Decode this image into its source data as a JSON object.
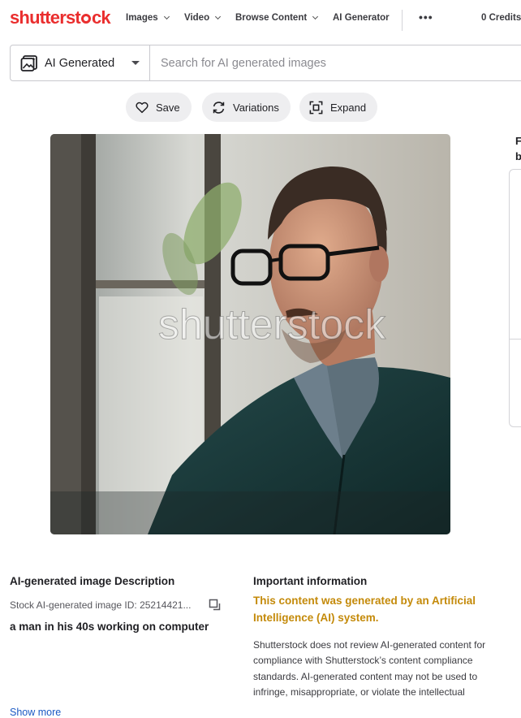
{
  "header": {
    "logo": {
      "left": "shutterst",
      "right": "ck"
    },
    "nav": [
      {
        "label": "Images",
        "has_menu": true
      },
      {
        "label": "Video",
        "has_menu": true
      },
      {
        "label": "Browse Content",
        "has_menu": true
      },
      {
        "label": "AI Generator",
        "has_menu": false
      }
    ],
    "more_icon": "more-horizontal-icon",
    "credits": "0 Credits"
  },
  "search": {
    "asset_type": "AI Generated",
    "placeholder": "Search for AI generated images",
    "value": ""
  },
  "actions": [
    {
      "label": "Save",
      "icon": "heart-icon"
    },
    {
      "label": "Variations",
      "icon": "refresh-icon"
    },
    {
      "label": "Expand",
      "icon": "expand-icon"
    }
  ],
  "image": {
    "watermark": "shutterstock"
  },
  "side_panel": {
    "line1": "F",
    "line2": "b"
  },
  "description": {
    "heading": "AI-generated image Description",
    "stock_id": "Stock AI-generated image ID: 25214421...",
    "caption": "a man in his 40s working on computer",
    "show_more": "Show more"
  },
  "important": {
    "heading": "Important information",
    "ai_notice": "This content was generated by an Artificial Intelligence (AI) system.",
    "body": "Shutterstock does not review AI-generated content for compliance with Shutterstock’s content compliance standards. AI-generated content may not be used to infringe, misappropriate, or violate the intellectual"
  },
  "colors": {
    "brand": "#ea2e2e",
    "link": "#1a59c4",
    "ai_notice": "#c48a0a",
    "pill_bg": "#eeeef0"
  }
}
